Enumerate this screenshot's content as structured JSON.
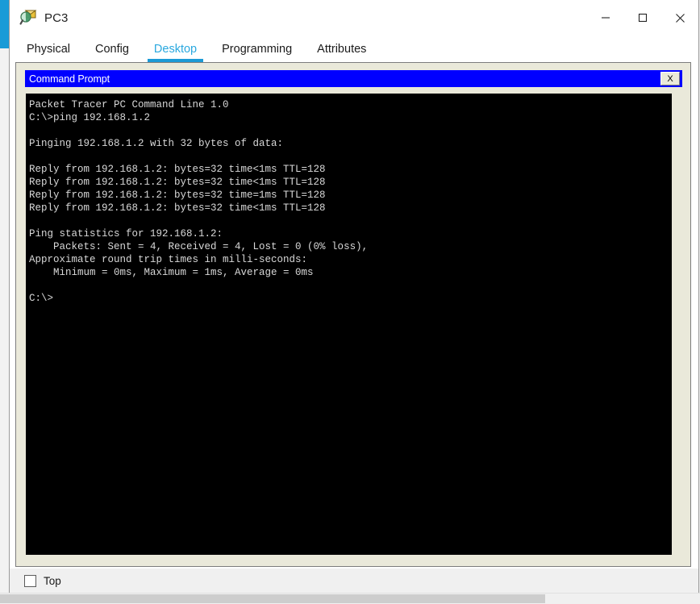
{
  "window": {
    "title": "PC3",
    "icon": "packet-tracer-pc-icon",
    "controls": {
      "minimize": "minimize-icon",
      "maximize": "maximize-icon",
      "close": "close-icon"
    }
  },
  "tabs": [
    {
      "label": "Physical",
      "active": false
    },
    {
      "label": "Config",
      "active": false
    },
    {
      "label": "Desktop",
      "active": true
    },
    {
      "label": "Programming",
      "active": false
    },
    {
      "label": "Attributes",
      "active": false
    }
  ],
  "command_prompt": {
    "title": "Command Prompt",
    "close_label": "X",
    "terminal_lines": [
      "Packet Tracer PC Command Line 1.0",
      "C:\\>ping 192.168.1.2",
      "",
      "Pinging 192.168.1.2 with 32 bytes of data:",
      "",
      "Reply from 192.168.1.2: bytes=32 time<1ms TTL=128",
      "Reply from 192.168.1.2: bytes=32 time<1ms TTL=128",
      "Reply from 192.168.1.2: bytes=32 time=1ms TTL=128",
      "Reply from 192.168.1.2: bytes=32 time<1ms TTL=128",
      "",
      "Ping statistics for 192.168.1.2:",
      "    Packets: Sent = 4, Received = 4, Lost = 0 (0% loss),",
      "Approximate round trip times in milli-seconds:",
      "    Minimum = 0ms, Maximum = 1ms, Average = 0ms",
      "",
      "C:\\>"
    ]
  },
  "footer": {
    "top_checkbox_label": "Top",
    "top_checkbox_checked": false
  },
  "colors": {
    "accent": "#29a8df",
    "cmd_titlebar": "#0000ff",
    "panel": "#eae9da",
    "terminal_bg": "#000000",
    "terminal_fg": "#d8d8d8"
  }
}
